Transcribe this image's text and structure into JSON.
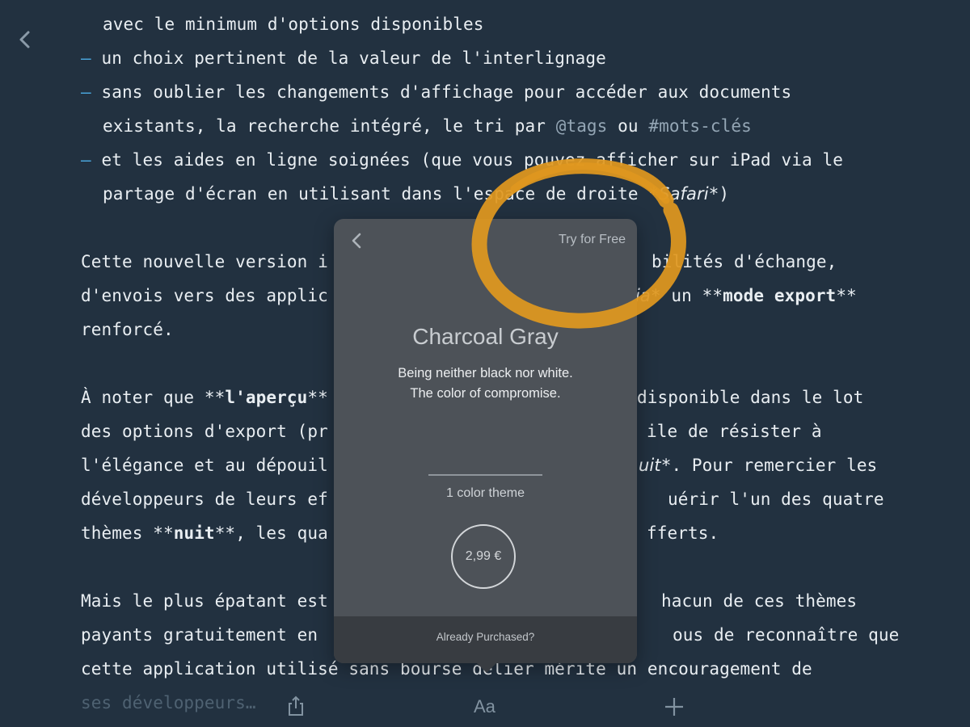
{
  "editor": {
    "l1": "avec le minimum d'options disponibles",
    "dash": "–",
    "l2": "un choix pertinent de la valeur de l'interlignage",
    "l3": "sans oublier les changements d'affichage pour accéder aux documents",
    "l4a": "existants, la recherche intégré, le tri par ",
    "l4tag": "@tags",
    "l4ou": " ou ",
    "l4kw": "#mots-clés",
    "l5": "et les aides en ligne soignées (que vous pouvez afficher sur iPad via le",
    "l6a": "partage d'écran en utilisant dans l'espace de droite ",
    "l6m1": "*",
    "l6b": "Safari",
    "l6m2": "*",
    "l6c": ")",
    "l7": "Cette nouvelle version i",
    "l7r": "bilités d'échange,",
    "l8": "d'envois vers des applic",
    "l8i": "ia",
    "l8m": "* un ",
    "l8stars1": "**",
    "l8b": "mode export",
    "l8stars2": "**",
    "l9": "renforcé.",
    "l10a": "À noter que ",
    "l10s1": "**",
    "l10b": "l'aperçu",
    "l10s2": "**",
    "l10r": "disponible dans le lot",
    "l11": "des options d'export (pr",
    "l11r": "ile de résister à",
    "l12": "l'élégance et au dépouil",
    "l12i": "uit",
    "l12m": "*",
    "l12r": ". Pour remercier les",
    "l13": "développeurs de leurs ef",
    "l13r": "uérir l'un des quatre",
    "l14a": "thèmes ",
    "l14s1": "**",
    "l14b": "nuit",
    "l14s2": "**",
    "l14c": ", les qua",
    "l14r": "fferts.",
    "l15": "Mais le plus épatant est",
    "l15r": "hacun de ces thèmes",
    "l16": "payants gratuitement en",
    "l16r": "ous de reconnaître que",
    "l17": "cette application utilisé sans bourse délier mérite un encouragement de",
    "l18": "ses développeurs…"
  },
  "toolbar": {
    "font_label": "Aa"
  },
  "popover": {
    "try_for_free": "Try for Free",
    "title": "Charcoal Gray",
    "desc_line1": "Being neither black nor white.",
    "desc_line2": "The color of compromise.",
    "count": "1 color theme",
    "price": "2,99 €",
    "already_purchased": "Already Purchased?"
  },
  "colors": {
    "background": "#223140",
    "popover": "#4d5258",
    "accent_ring": "#e0981f",
    "list_dash": "#4aa6dc"
  },
  "icons": [
    "chevron-left-icon",
    "share-icon",
    "plus-icon"
  ]
}
